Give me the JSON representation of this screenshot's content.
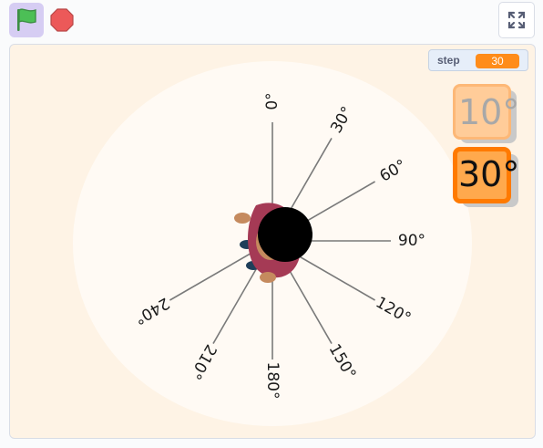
{
  "toolbar": {
    "green_flag_icon": "green-flag-icon",
    "stop_icon": "stop-icon",
    "fullscreen_icon": "fullscreen-icon",
    "colors": {
      "flag": "#4cbf56",
      "stop": "#ec5959",
      "flag_bg": "#d6cdf3"
    }
  },
  "monitor": {
    "label": "step",
    "value": "30"
  },
  "cards": [
    {
      "text": "10°",
      "selected": false
    },
    {
      "text": "30°",
      "selected": true
    }
  ],
  "dial": {
    "labels": [
      "0°",
      "30°",
      "60°",
      "90°",
      "120°",
      "150°",
      "180°",
      "210°",
      "240°"
    ]
  },
  "colors": {
    "stage_bg": "#fef3e5",
    "accent": "#ff8c1a"
  }
}
